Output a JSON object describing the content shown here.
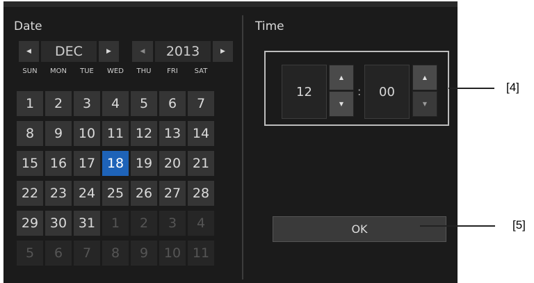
{
  "date_label": "Date",
  "time_label": "Time",
  "month_nav": {
    "prev_glyph": "◀",
    "value": "DEC",
    "next_glyph": "▶"
  },
  "year_nav": {
    "prev_glyph": "◀",
    "value": "2013",
    "next_glyph": "▶"
  },
  "weekdays": [
    "SUN",
    "MON",
    "TUE",
    "WED",
    "THU",
    "FRI",
    "SAT"
  ],
  "weeks": [
    [
      "1",
      "2",
      "3",
      "4",
      "5",
      "6",
      "7"
    ],
    [
      "8",
      "9",
      "10",
      "11",
      "12",
      "13",
      "14"
    ],
    [
      "15",
      "16",
      "17",
      "18",
      "19",
      "20",
      "21"
    ],
    [
      "22",
      "23",
      "24",
      "25",
      "26",
      "27",
      "28"
    ],
    [
      "29",
      "30",
      "31",
      "1",
      "2",
      "3",
      "4"
    ],
    [
      "5",
      "6",
      "7",
      "8",
      "9",
      "10",
      "11"
    ]
  ],
  "selected_day": "18",
  "time": {
    "hour": "12",
    "separator": ":",
    "minute": "00",
    "up_glyph": "▲",
    "down_glyph": "▼"
  },
  "ok_label": "OK",
  "callouts": {
    "time": "[4]",
    "ok": "[5]"
  },
  "colors": {
    "selected": "#1e63b8",
    "panel": "#1b1b1b",
    "cell": "#353535"
  }
}
